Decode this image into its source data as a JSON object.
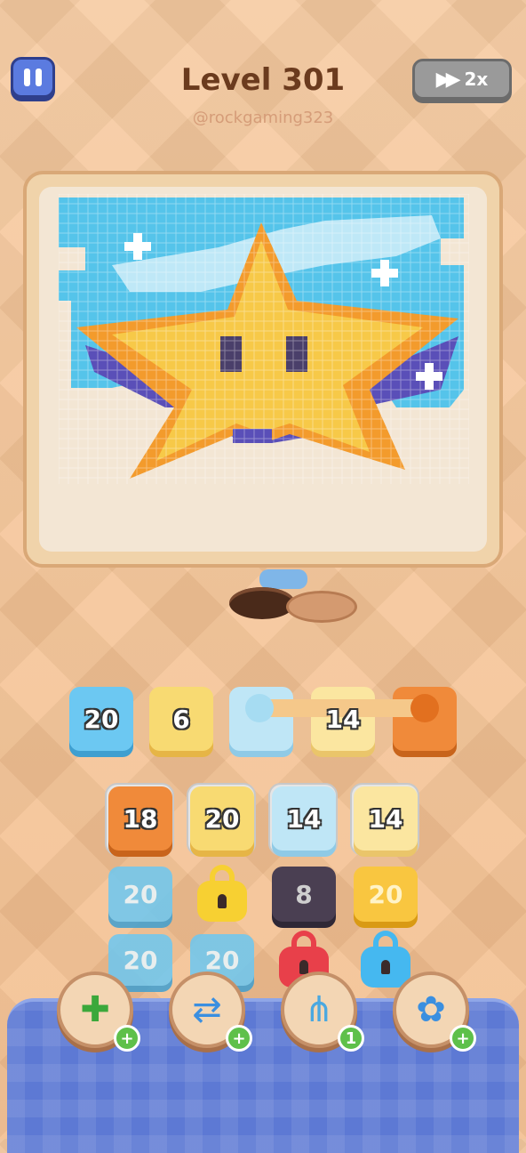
{
  "header": {
    "level_title": "Level 301",
    "username": "@rockgaming323",
    "speed_label": "2x"
  },
  "queue": [
    {
      "value": "20",
      "color": "blue"
    },
    {
      "value": "6",
      "color": "yellow"
    },
    {
      "value": "",
      "color": "light-blue"
    },
    {
      "value": "14",
      "color": "cream"
    },
    {
      "value": "",
      "color": "orange"
    }
  ],
  "grid": {
    "row1": [
      "18",
      "20",
      "14",
      "14"
    ],
    "row2": [
      "20",
      "",
      "8",
      "20"
    ],
    "row3": [
      "20",
      "20",
      "",
      ""
    ]
  },
  "powerups": [
    {
      "icon": "add-box-icon",
      "badge": "+"
    },
    {
      "icon": "shuffle-arrows-icon",
      "badge": "+"
    },
    {
      "icon": "claw-magnet-icon",
      "badge": "1"
    },
    {
      "icon": "flower-gear-icon",
      "badge": "+"
    }
  ],
  "colors": {
    "blue": "#6cc8f2",
    "yellow": "#f8da72",
    "orange": "#f08a3a",
    "star": "#f7c948",
    "sky": "#55c4ea"
  }
}
